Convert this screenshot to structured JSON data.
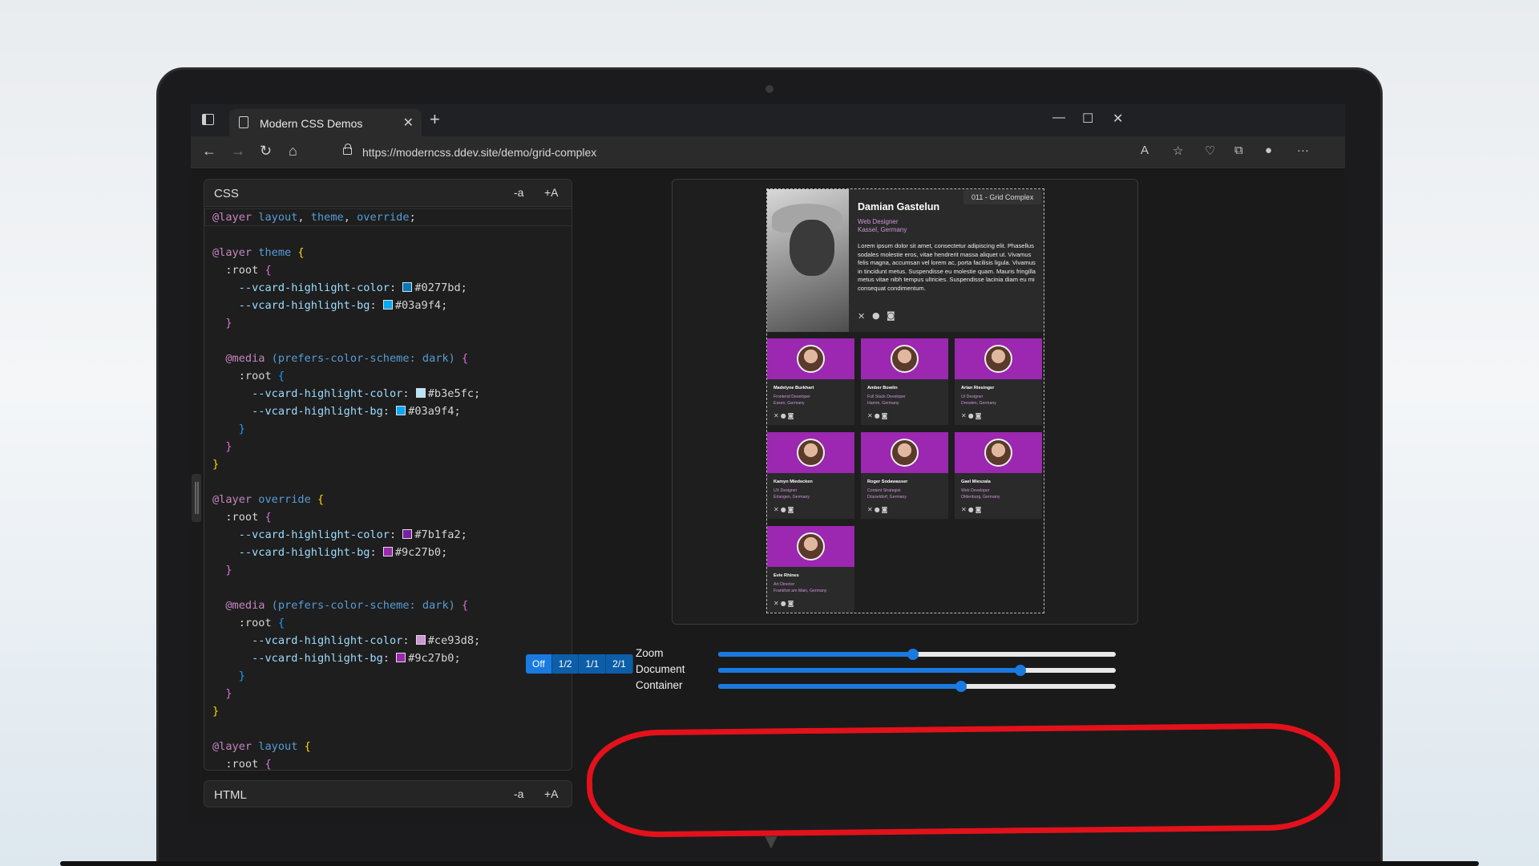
{
  "browser": {
    "tab_title": "Modern CSS Demos",
    "url": "https://moderncss.ddev.site/demo/grid-complex"
  },
  "css_panel": {
    "title": "CSS",
    "decrease_label": "-a",
    "increase_label": "+A",
    "lines": [
      "@layer layout, theme, override;",
      "",
      "@layer theme {",
      "  :root {",
      "    --vcard-highlight-color: #0277bd;",
      "    --vcard-highlight-bg: #03a9f4;",
      "  }",
      "",
      "  @media (prefers-color-scheme: dark) {",
      "    :root {",
      "      --vcard-highlight-color: #b3e5fc;",
      "      --vcard-highlight-bg: #03a9f4;",
      "    }",
      "  }",
      "}",
      "",
      "@layer override {",
      "  :root {",
      "    --vcard-highlight-color: #7b1fa2;",
      "    --vcard-highlight-bg: #9c27b0;",
      "  }",
      "",
      "  @media (prefers-color-scheme: dark) {",
      "    :root {",
      "      --vcard-highlight-color: #ce93d8;",
      "      --vcard-highlight-bg: #9c27b0;",
      "    }",
      "  }",
      "}",
      "",
      "@layer layout {",
      "  :root {"
    ]
  },
  "html_panel": {
    "title": "HTML",
    "decrease_label": "-a",
    "increase_label": "+A"
  },
  "preview": {
    "label": "011 - Grid Complex",
    "main_card": {
      "name": "Damian Gastelun",
      "role": "Web Designer",
      "location": "Kassel, Germany",
      "bio": "Lorem ipsum dolor sit amet, consectetur adipiscing elit. Phasellus sodales molestie eros, vitae hendrerit massa aliquet ut. Vivamus felis magna, accumsan vel lorem ac, porta facilisis ligula. Vivamus in tincidunt metus. Suspendisse eu molestie quam. Mauris fringilla metus vitae nibh tempus ultricies. Suspendisse lacinia diam eu mi consequat condimentum."
    },
    "cards": [
      {
        "name": "Madelyne Burkhart",
        "role": "Frontend Developer",
        "location": "Essen, Germany"
      },
      {
        "name": "Amber Bowlin",
        "role": "Full Stack Developer",
        "location": "Hamm, Germany"
      },
      {
        "name": "Arlan Riesinger",
        "role": "UI Designer",
        "location": "Dresden, Germany"
      },
      {
        "name": "Kamyn Miedecken",
        "role": "UX Designer",
        "location": "Erlangen, Germany"
      },
      {
        "name": "Roger Sodawasser",
        "role": "Content Strategist",
        "location": "Düsseldorf, Germany"
      },
      {
        "name": "Gael Mieszala",
        "role": "Web Developer",
        "location": "Oldenburg, Germany"
      },
      {
        "name": "Evie Rhines",
        "role": "Art Director",
        "location": "Frankfurt am Main, Germany"
      }
    ]
  },
  "controls": {
    "modes": [
      "Off",
      "1/2",
      "1/1",
      "2/1"
    ],
    "active_mode": "Off",
    "zoom_label": "Zoom",
    "document_label": "Document",
    "container_label": "Container",
    "zoom_value": 0.49,
    "document_value": 0.76,
    "container_value": 0.61
  },
  "colors": {
    "accent": "#1a7ae0",
    "highlight_bg": "#9c27b0",
    "highlight_color": "#ce93d8",
    "annotation": "#e3111b"
  }
}
